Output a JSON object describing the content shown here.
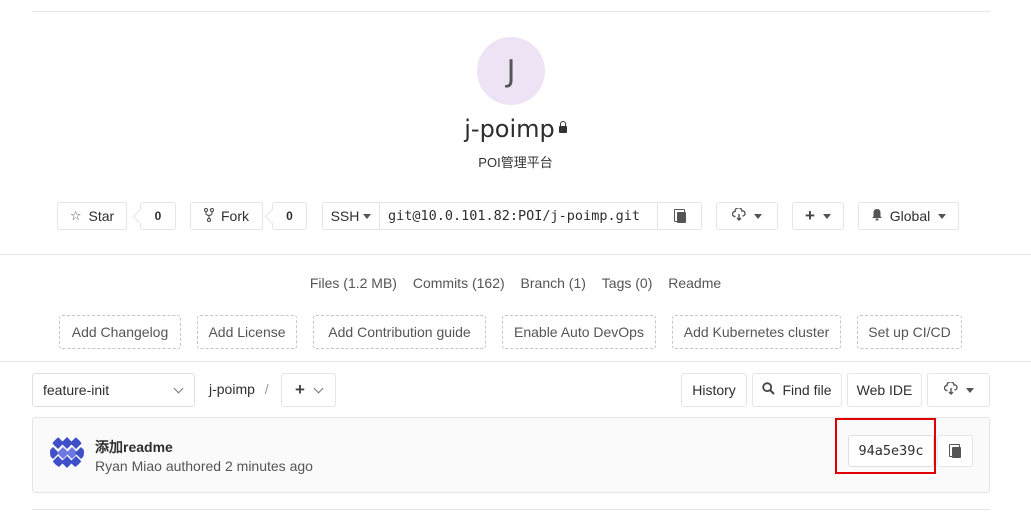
{
  "project": {
    "avatar_letter": "J",
    "name": "j-poimp",
    "visibility_icon": "lock-icon",
    "description": "POI管理平台"
  },
  "actions": {
    "star_label": "Star",
    "star_count": "0",
    "fork_label": "Fork",
    "fork_count": "0",
    "clone_protocol": "SSH",
    "clone_url": "git@10.0.101.82:POI/j-poimp.git",
    "notification_label": "Global"
  },
  "stats": {
    "files": "Files (1.2 MB)",
    "commits": "Commits (162)",
    "branch": "Branch (1)",
    "tags": "Tags (0)",
    "readme": "Readme"
  },
  "quick_actions": [
    "Add Changelog",
    "Add License",
    "Add Contribution guide",
    "Enable Auto DevOps",
    "Add Kubernetes cluster",
    "Set up CI/CD"
  ],
  "tree": {
    "branch": "feature-init",
    "path_root": "j-poimp",
    "path_sep": "/",
    "history_label": "History",
    "find_file_label": "Find file",
    "web_ide_label": "Web IDE"
  },
  "last_commit": {
    "title": "添加readme",
    "author": "Ryan Miao",
    "action": "authored",
    "time": "2 minutes ago",
    "sha": "94a5e39c"
  },
  "colors": {
    "avatar_bg": "#eee3f5",
    "highlight": "#e10000",
    "border": "#e5e5e5"
  }
}
